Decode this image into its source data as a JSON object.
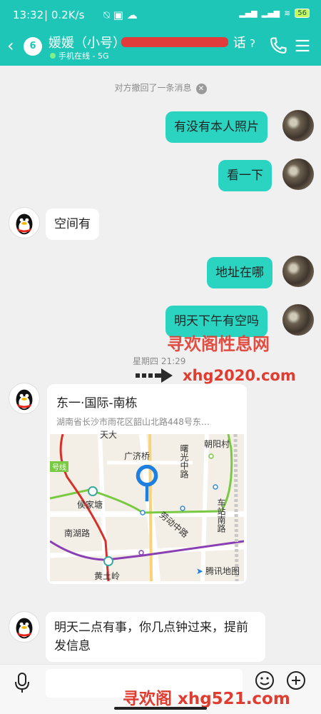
{
  "status_bar": {
    "time": "13:32",
    "network_speed": "| 0.2K/s",
    "battery": "56"
  },
  "header": {
    "unread_count": "6",
    "title": "媛媛（小号）",
    "title_tail": "话",
    "subtitle": "手机在线 - 5G",
    "accent_color": "#1dc6b7"
  },
  "system_message": "对方撤回了一条消息",
  "messages": [
    {
      "side": "mine",
      "text": "有没有本人照片"
    },
    {
      "side": "mine",
      "text": "看一下"
    },
    {
      "side": "theirs",
      "text": "空间有"
    },
    {
      "side": "mine",
      "text": "地址在哪"
    },
    {
      "side": "mine",
      "text": "明天下午有空吗"
    },
    {
      "side": "theirs",
      "text": "明天二点有事，你几点钟过来，提前发信息"
    }
  ],
  "time_separator": "星期四 21:29",
  "location": {
    "title": "东一·国际-南栋",
    "address": "湖南省长沙市雨花区韶山北路448号东…",
    "map_labels": {
      "guangji": "广济桥",
      "houjiatang": "侯家塘",
      "nanhulu": "南湖路",
      "huangtuling": "黄土岭",
      "chaoyangcun": "朝阳村",
      "shuguang": "曙光中路",
      "laodong": "劳动中路",
      "chezhan": "车站南路",
      "line_tag": "号线",
      "top_clip": "天大"
    },
    "map_brand": "腾讯地图"
  },
  "watermarks": {
    "wm1": "寻欢阁性息网",
    "wm2": "xhg2020.com",
    "wm3": "寻欢阁 xhg521.com"
  },
  "icons": [
    "back-icon",
    "phone-icon",
    "menu-icon",
    "mic-icon",
    "emoji-icon",
    "plus-icon",
    "map-pin-icon"
  ]
}
